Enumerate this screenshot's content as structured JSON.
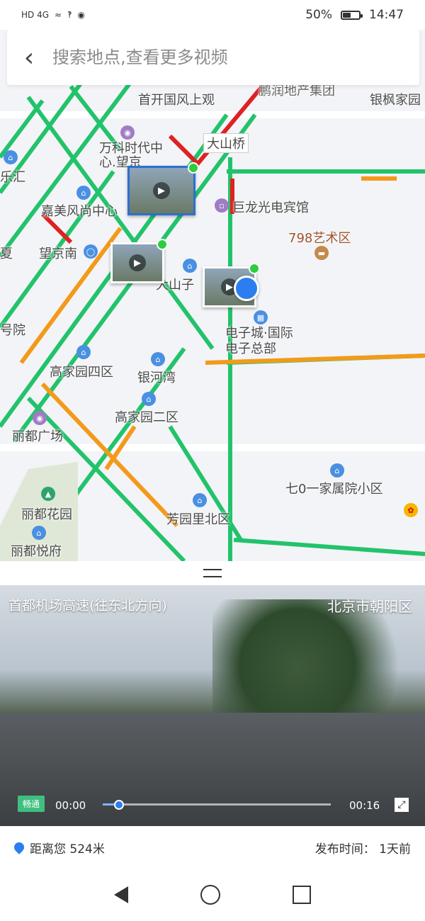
{
  "status": {
    "signal": "HD 4G",
    "battery_percent": "50%",
    "battery_level": 0.5,
    "time": "14:47"
  },
  "search": {
    "placeholder": "搜索地点,查看更多视频"
  },
  "map": {
    "pois": [
      {
        "label": "首开国风上观"
      },
      {
        "label": "鹏润地产集团"
      },
      {
        "label": "银枫家园"
      },
      {
        "label": "万科时代中心.望京"
      },
      {
        "label": "大山桥"
      },
      {
        "label": "嘉美风尚中心"
      },
      {
        "label": "巨龙光电宾馆"
      },
      {
        "label": "798艺术区"
      },
      {
        "label": "望京南"
      },
      {
        "label": "大山子"
      },
      {
        "label": "电子城·国际电子总部"
      },
      {
        "label": "高家园四区"
      },
      {
        "label": "银河湾"
      },
      {
        "label": "高家园二区"
      },
      {
        "label": "丽都广场"
      },
      {
        "label": "七0一家属院小区"
      },
      {
        "label": "丽都花园"
      },
      {
        "label": "芳园里北区"
      },
      {
        "label": "丽都悦府"
      },
      {
        "label": "号院"
      },
      {
        "label": "乐汇"
      },
      {
        "label": "夏"
      }
    ]
  },
  "video": {
    "road_name": "首都机场高速(往东北方向)",
    "district": "北京市朝阳区",
    "traffic_status": "畅通",
    "current_time": "00:00",
    "duration": "00:16",
    "progress": 0.07
  },
  "info": {
    "distance": "距离您 524米",
    "publish": "发布时间： 1天前"
  }
}
